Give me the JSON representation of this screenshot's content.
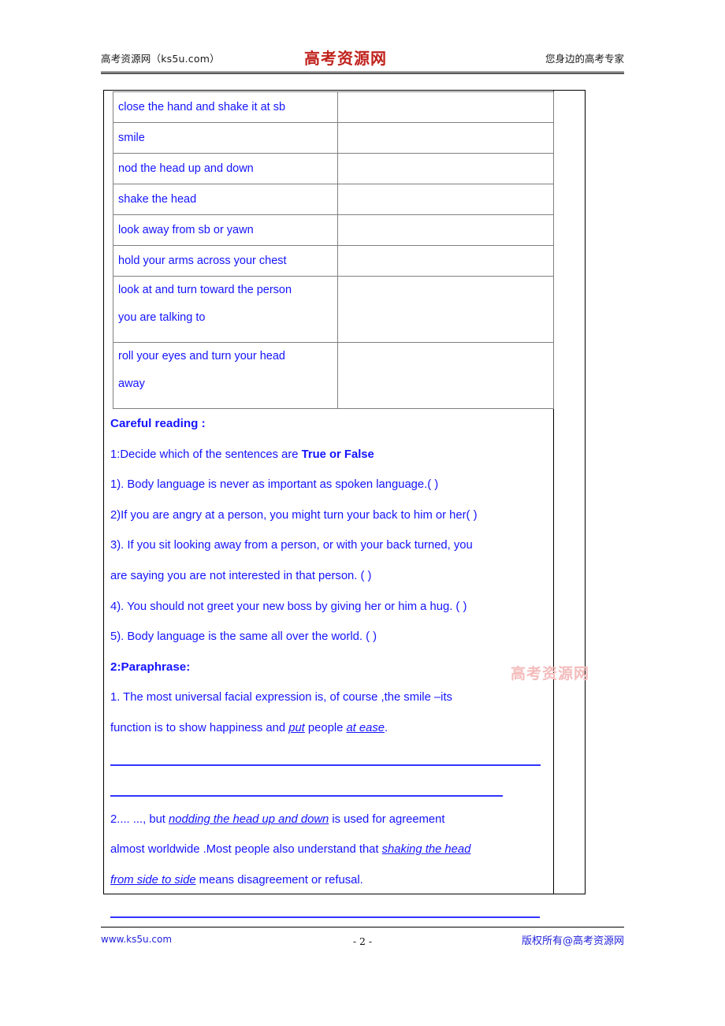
{
  "header": {
    "left": "高考资源网（ks5u.com）",
    "logo": "高考资源网",
    "right": "您身边的高考专家"
  },
  "watermark": "高考资源网",
  "gesture_table": {
    "rows": [
      {
        "gesture": [
          "close the hand and shake it at sb"
        ],
        "meaning": ""
      },
      {
        "gesture": [
          "smile"
        ],
        "meaning": ""
      },
      {
        "gesture": [
          "nod the head up and down"
        ],
        "meaning": ""
      },
      {
        "gesture": [
          "shake the head"
        ],
        "meaning": ""
      },
      {
        "gesture": [
          "look away from sb or yawn"
        ],
        "meaning": ""
      },
      {
        "gesture": [
          "hold your arms across your chest"
        ],
        "meaning": ""
      },
      {
        "gesture": [
          "look at and turn toward the person",
          "you are talking to"
        ],
        "meaning": ""
      },
      {
        "gesture": [
          "roll your eyes and turn your head",
          "away"
        ],
        "meaning": ""
      }
    ]
  },
  "careful_reading": {
    "heading": "Careful reading :",
    "task1": {
      "prompt_plain": "1:Decide which of the sentences are ",
      "prompt_bold": "True or False",
      "items": [
        "1). Body language is never as important as spoken language.( )",
        "2)If you are angry at a person, you might turn your back to him or her( )",
        "3). If you sit looking away from a person, or with your back turned, you",
        "are saying you are not interested in that person. ( )",
        "4). You should not greet your new boss by giving her or him a hug. ( )",
        "5). Body language is the same all over the world. ( )"
      ]
    },
    "task2": {
      "heading": "2:Paraphrase:",
      "q1_line1": "1. The most universal facial expression is, of course ,the smile –its",
      "q1_line2_a": "function is to show happiness and ",
      "q1_line2_em1": "put",
      "q1_line2_b": " people ",
      "q1_line2_em2": "at ease",
      "q1_line2_c": ".",
      "q2_line1_a": "2.... ..., but ",
      "q2_line1_em": "nodding the head up and down",
      "q2_line1_b": "  is used for agreement",
      "q2_line2_a": "almost worldwide .Most people also understand that ",
      "q2_line2_em": "shaking the head",
      "q2_line3_em": "from side to side",
      "q2_line3_b": " means disagreement or refusal."
    }
  },
  "footer": {
    "left": "www.ks5u.com",
    "center": "- 2 -",
    "right": "版权所有@高考资源网"
  }
}
